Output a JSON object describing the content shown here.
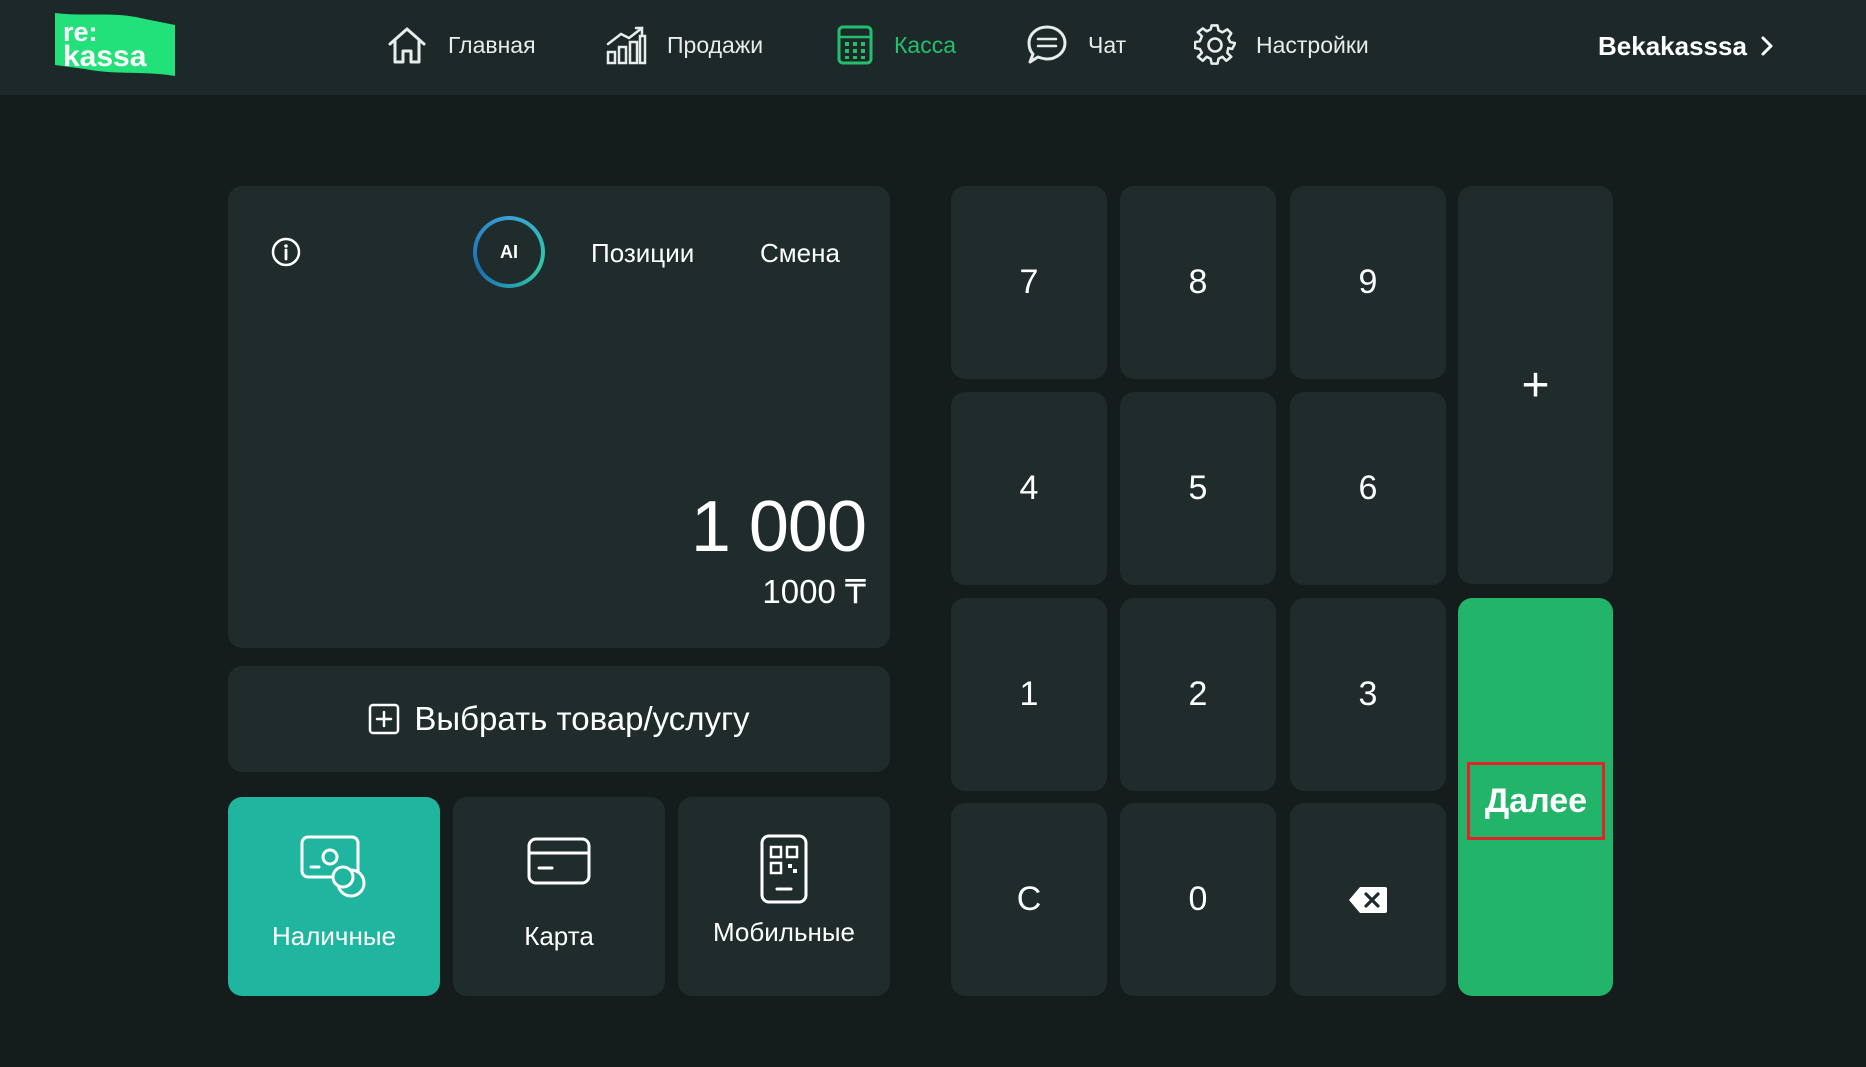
{
  "app": {
    "logo_line1": "re:",
    "logo_line2": "kassa",
    "brand_color": "#22c06e"
  },
  "nav": {
    "items": [
      {
        "label": "Главная",
        "icon": "home-icon"
      },
      {
        "label": "Продажи",
        "icon": "sales-chart-icon"
      },
      {
        "label": "Касса",
        "icon": "calculator-icon",
        "active": true
      },
      {
        "label": "Чат",
        "icon": "chat-icon"
      },
      {
        "label": "Настройки",
        "icon": "gear-icon"
      }
    ],
    "user_name": "Bekakasssa"
  },
  "amount_panel": {
    "ai_label": "AI",
    "tabs": [
      "Позиции",
      "Смена"
    ],
    "amount_display": "1 000",
    "amount_sub": "1000 ₸"
  },
  "select_product": {
    "label": "Выбрать товар/услугу"
  },
  "payment_methods": [
    {
      "label": "Наличные",
      "icon": "cash-icon",
      "selected": true,
      "color": "#1fb59f"
    },
    {
      "label": "Карта",
      "icon": "card-icon",
      "selected": false
    },
    {
      "label": "Мобильные",
      "icon": "mobile-qr-icon",
      "selected": false
    }
  ],
  "keypad": {
    "rows": [
      [
        "7",
        "8",
        "9"
      ],
      [
        "4",
        "5",
        "6"
      ],
      [
        "1",
        "2",
        "3"
      ],
      [
        "C",
        "0",
        "⌫"
      ]
    ],
    "plus_label": "+",
    "next_label": "Далее",
    "next_color": "#22b56a"
  }
}
